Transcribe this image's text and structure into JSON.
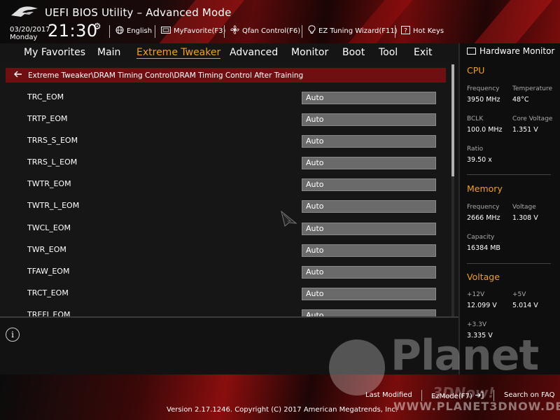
{
  "header": {
    "title": "UEFI BIOS Utility – Advanced Mode",
    "date": "03/20/2017",
    "day": "Monday",
    "time": "21:30",
    "tools": [
      {
        "label": "English",
        "icon": "globe-icon"
      },
      {
        "label": "MyFavorite(F3)",
        "icon": "favorite-folder-icon"
      },
      {
        "label": "Qfan Control(F6)",
        "icon": "fan-icon"
      },
      {
        "label": "EZ Tuning Wizard(F11)",
        "icon": "lightbulb-icon"
      },
      {
        "label": "Hot Keys",
        "icon": "question-box-icon"
      }
    ]
  },
  "menu": {
    "tabs": [
      "My Favorites",
      "Main",
      "Extreme Tweaker",
      "Advanced",
      "Monitor",
      "Boot",
      "Tool",
      "Exit"
    ],
    "active": "Extreme Tweaker"
  },
  "breadcrumb": "Extreme Tweaker\\DRAM Timing Control\\DRAM Timing Control After Training",
  "settings": [
    {
      "label": "TRC_EOM",
      "value": "Auto"
    },
    {
      "label": "TRTP_EOM",
      "value": "Auto"
    },
    {
      "label": "TRRS_S_EOM",
      "value": "Auto"
    },
    {
      "label": "TRRS_L_EOM",
      "value": "Auto"
    },
    {
      "label": "TWTR_EOM",
      "value": "Auto"
    },
    {
      "label": "TWTR_L_EOM",
      "value": "Auto"
    },
    {
      "label": "TWCL_EOM",
      "value": "Auto"
    },
    {
      "label": "TWR_EOM",
      "value": "Auto"
    },
    {
      "label": "TFAW_EOM",
      "value": "Auto"
    },
    {
      "label": "TRCT_EOM",
      "value": "Auto"
    },
    {
      "label": "TREFI_EOM",
      "value": "Auto"
    }
  ],
  "hwmon": {
    "title": "Hardware Monitor",
    "cpu": {
      "heading": "CPU",
      "frequency_label": "Frequency",
      "frequency": "3950 MHz",
      "temperature_label": "Temperature",
      "temperature": "48°C",
      "bclk_label": "BCLK",
      "bclk": "100.0 MHz",
      "core_voltage_label": "Core Voltage",
      "core_voltage": "1.351 V",
      "ratio_label": "Ratio",
      "ratio": "39.50 x"
    },
    "memory": {
      "heading": "Memory",
      "frequency_label": "Frequency",
      "frequency": "2666 MHz",
      "voltage_label": "Voltage",
      "voltage": "1.308 V",
      "capacity_label": "Capacity",
      "capacity": "16384 MB"
    },
    "voltage": {
      "heading": "Voltage",
      "v12_label": "+12V",
      "v12": "12.099 V",
      "v5_label": "+5V",
      "v5": "5.014 V",
      "v33_label": "+3.3V",
      "v33": "3.335 V"
    }
  },
  "footer": {
    "last_modified": "Last Modified",
    "ezmode": "EzMode(F7)",
    "search": "Search on FAQ",
    "version": "Version 2.17.1246. Copyright (C) 2017 American Megatrends, Inc."
  },
  "watermark": {
    "name": "Planet",
    "sub": "3DNow!",
    "url": "WWW.PLANET3DNOW.DE"
  },
  "colors": {
    "accent": "#f0a020",
    "breadcrumb_bg": "#6e0f12",
    "field_bg": "#6a6a6a"
  }
}
